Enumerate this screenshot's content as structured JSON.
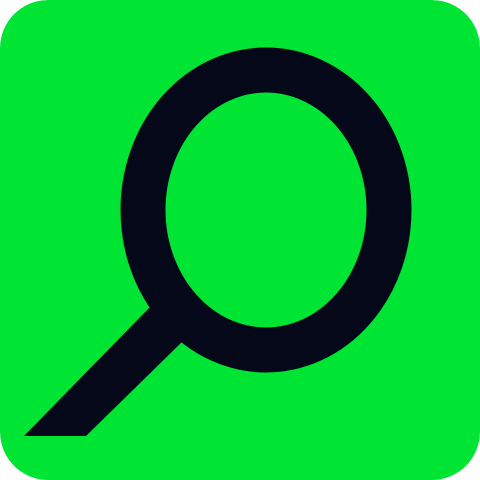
{
  "app_icon": {
    "icon": "search-icon",
    "colors": {
      "background": "#00E533",
      "glyph": "#040818"
    }
  }
}
